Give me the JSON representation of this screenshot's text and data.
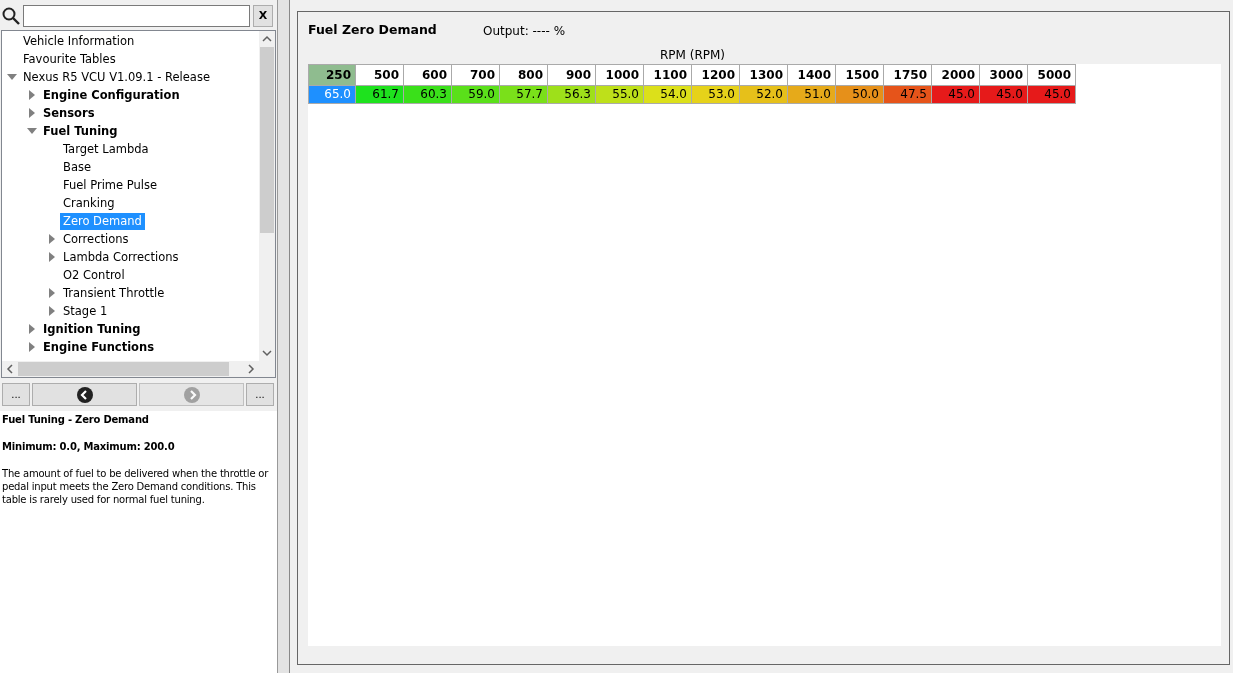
{
  "search": {
    "clear_label": "X"
  },
  "tree": [
    {
      "label": "Vehicle Information",
      "selected": false
    },
    {
      "label": "Favourite Tables",
      "selected": false
    },
    {
      "label": "Nexus R5 VCU V1.09.1 - Release",
      "selected": false,
      "expanded": true,
      "children": [
        {
          "label": "Engine Configuration",
          "selected": false,
          "expanded": false
        },
        {
          "label": "Sensors",
          "selected": false,
          "expanded": false
        },
        {
          "label": "Fuel Tuning",
          "selected": false,
          "expanded": true,
          "children": [
            {
              "label": "Target Lambda",
              "selected": false
            },
            {
              "label": "Base",
              "selected": false
            },
            {
              "label": "Fuel Prime Pulse",
              "selected": false
            },
            {
              "label": "Cranking",
              "selected": false
            },
            {
              "label": "Zero Demand",
              "selected": true
            },
            {
              "label": "Corrections",
              "selected": false,
              "expanded": false
            },
            {
              "label": "Lambda Corrections",
              "selected": false,
              "expanded": false
            },
            {
              "label": "O2 Control",
              "selected": false
            },
            {
              "label": "Transient Throttle",
              "selected": false,
              "expanded": false
            },
            {
              "label": "Stage 1",
              "selected": false,
              "expanded": false
            }
          ]
        },
        {
          "label": "Ignition Tuning",
          "selected": false,
          "expanded": false
        },
        {
          "label": "Engine Functions",
          "selected": false,
          "expanded": false
        }
      ]
    }
  ],
  "nav_buttons": [
    {
      "kind": "more",
      "label": "...",
      "disabled": false
    },
    {
      "kind": "back",
      "disabled": false
    },
    {
      "kind": "forward",
      "disabled": true
    },
    {
      "kind": "more",
      "label": "...",
      "disabled": false
    }
  ],
  "help": {
    "title": "Fuel Tuning - Zero Demand",
    "range": "Minimum: 0.0, Maximum: 200.0",
    "description": "The amount of fuel to be delivered when the throttle or pedal input meets the Zero Demand conditions. This table is rarely used for normal fuel tuning."
  },
  "table_view": {
    "title": "Fuel Zero Demand",
    "output": "Output: ---- %",
    "axis_label": "RPM (RPM)",
    "cells": [
      {
        "rpm": "250",
        "value": "65.0",
        "color": "#1e90ff",
        "selected": true
      },
      {
        "rpm": "500",
        "value": "61.7",
        "color": "#1ee21e",
        "selected": false
      },
      {
        "rpm": "600",
        "value": "60.3",
        "color": "#3ae01a",
        "selected": false
      },
      {
        "rpm": "700",
        "value": "59.0",
        "color": "#5ae01a",
        "selected": false
      },
      {
        "rpm": "800",
        "value": "57.7",
        "color": "#7ae01a",
        "selected": false
      },
      {
        "rpm": "900",
        "value": "56.3",
        "color": "#9ee01a",
        "selected": false
      },
      {
        "rpm": "1000",
        "value": "55.0",
        "color": "#bee01a",
        "selected": false
      },
      {
        "rpm": "1100",
        "value": "54.0",
        "color": "#dce01a",
        "selected": false
      },
      {
        "rpm": "1200",
        "value": "53.0",
        "color": "#e6d21a",
        "selected": false
      },
      {
        "rpm": "1300",
        "value": "52.0",
        "color": "#e6c01a",
        "selected": false
      },
      {
        "rpm": "1400",
        "value": "51.0",
        "color": "#e6aa1a",
        "selected": false
      },
      {
        "rpm": "1500",
        "value": "50.0",
        "color": "#e6901a",
        "selected": false
      },
      {
        "rpm": "1750",
        "value": "47.5",
        "color": "#e6541a",
        "selected": false
      },
      {
        "rpm": "2000",
        "value": "45.0",
        "color": "#e61a1a",
        "selected": false
      },
      {
        "rpm": "3000",
        "value": "45.0",
        "color": "#e61a1a",
        "selected": false
      },
      {
        "rpm": "5000",
        "value": "45.0",
        "color": "#e61a1a",
        "selected": false
      }
    ]
  }
}
